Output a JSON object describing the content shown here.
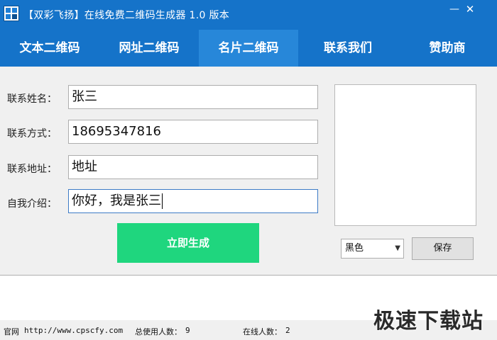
{
  "window": {
    "title": "【双彩飞扬】在线免费二维码生成器 1.0 版本",
    "minimize_glyph": "—",
    "close_glyph": "✕"
  },
  "tabs": [
    {
      "label": "文本二维码",
      "active": false
    },
    {
      "label": "网址二维码",
      "active": false
    },
    {
      "label": "名片二维码",
      "active": true
    },
    {
      "label": "联系我们",
      "active": false
    },
    {
      "label": "赞助商",
      "active": false
    }
  ],
  "form": {
    "name_label": "联系姓名：",
    "name_value": "张三",
    "contact_label": "联系方式：",
    "contact_value": "18695347816",
    "address_label": "联系地址：",
    "address_value": "地址",
    "intro_label": "自我介绍：",
    "intro_value": "你好，我是张三"
  },
  "generate_button": "立即生成",
  "color_select": {
    "selected": "黑色"
  },
  "save_button": "保存",
  "status": {
    "site_label": "官网",
    "site_url": "http://www.cpscfy.com",
    "total_users_label": "总使用人数：",
    "total_users": "9",
    "online_users_label": "在线人数：",
    "online_users": "2"
  },
  "watermark": "极速下载站",
  "colors": {
    "titlebar": "#1573c9",
    "active_tab": "#2787d9",
    "generate_button": "#1fd67e"
  },
  "icons": [
    "app-qr-icon",
    "minimize-icon",
    "close-icon",
    "dropdown-arrow-icon"
  ]
}
